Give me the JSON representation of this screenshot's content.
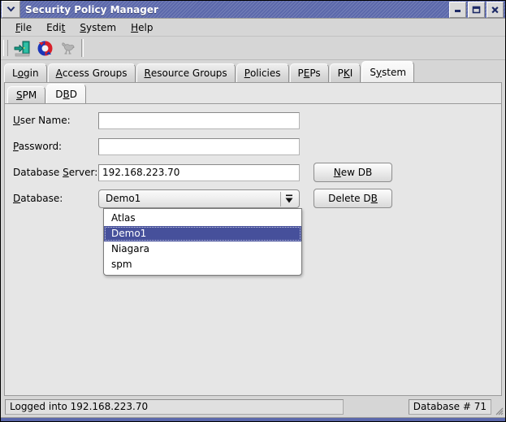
{
  "window": {
    "title": "Security Policy Manager",
    "menu_button_icon": "chevron-down-icon",
    "buttons": [
      {
        "name": "minimize",
        "icon": "minimize-icon"
      },
      {
        "name": "maximize",
        "icon": "maximize-icon"
      },
      {
        "name": "close",
        "icon": "close-icon"
      }
    ],
    "titlebar_color": "#5b68ab"
  },
  "menubar": {
    "items": [
      {
        "label": "File",
        "pre": "",
        "mn": "F",
        "post": "ile"
      },
      {
        "label": "Edit",
        "pre": "Edi",
        "mn": "t",
        "post": ""
      },
      {
        "label": "System",
        "pre": "",
        "mn": "S",
        "post": "ystem"
      },
      {
        "label": "Help",
        "pre": "",
        "mn": "H",
        "post": "elp"
      }
    ]
  },
  "toolbar": {
    "items": [
      {
        "name": "login-door-icon",
        "tooltip": "Login"
      },
      {
        "name": "refresh-icon",
        "tooltip": "Refresh"
      },
      {
        "name": "bird-icon",
        "tooltip": "Bird"
      }
    ]
  },
  "tabs": {
    "items": [
      {
        "pre": "L",
        "mn": "o",
        "post": "gin",
        "active": false
      },
      {
        "pre": "",
        "mn": "A",
        "post": "ccess Groups",
        "active": false
      },
      {
        "pre": "",
        "mn": "R",
        "post": "esource Groups",
        "active": false
      },
      {
        "pre": "",
        "mn": "P",
        "post": "olicies",
        "active": false
      },
      {
        "pre": "P",
        "mn": "E",
        "post": "Ps",
        "active": false
      },
      {
        "pre": "P",
        "mn": "K",
        "post": "I",
        "active": false
      },
      {
        "pre": "S",
        "mn": "y",
        "post": "stem",
        "active": true
      }
    ]
  },
  "subtabs": {
    "items": [
      {
        "pre": "",
        "mn": "S",
        "post": "PM",
        "active": false
      },
      {
        "pre": "D",
        "mn": "B",
        "post": "D",
        "active": true
      }
    ]
  },
  "form": {
    "username": {
      "label_pre": "",
      "label_mn": "U",
      "label_post": "ser Name:",
      "value": "",
      "placeholder": ""
    },
    "password": {
      "label_pre": "",
      "label_mn": "P",
      "label_post": "assword:",
      "value": "",
      "placeholder": ""
    },
    "database_server": {
      "label_pre": "Database ",
      "label_mn": "S",
      "label_post": "erver:",
      "value": "192.168.223.70",
      "placeholder": ""
    },
    "database": {
      "label_pre": "",
      "label_mn": "D",
      "label_post": "atabase:",
      "selected": "Demo1",
      "options": [
        "Atlas",
        "Demo1",
        "Niagara",
        "spm"
      ],
      "expanded": true,
      "arrow_icon": "dropdown-arrow-icon",
      "highlight_color": "#46509b"
    },
    "new_db_button": {
      "pre": "",
      "mn": "N",
      "post": "ew DB"
    },
    "delete_db_button": {
      "pre": "Delete D",
      "mn": "B",
      "post": ""
    }
  },
  "statusbar": {
    "left": "Logged into 192.168.223.70",
    "right": "Database # 71",
    "grip_icon": "resize-grip-icon"
  }
}
